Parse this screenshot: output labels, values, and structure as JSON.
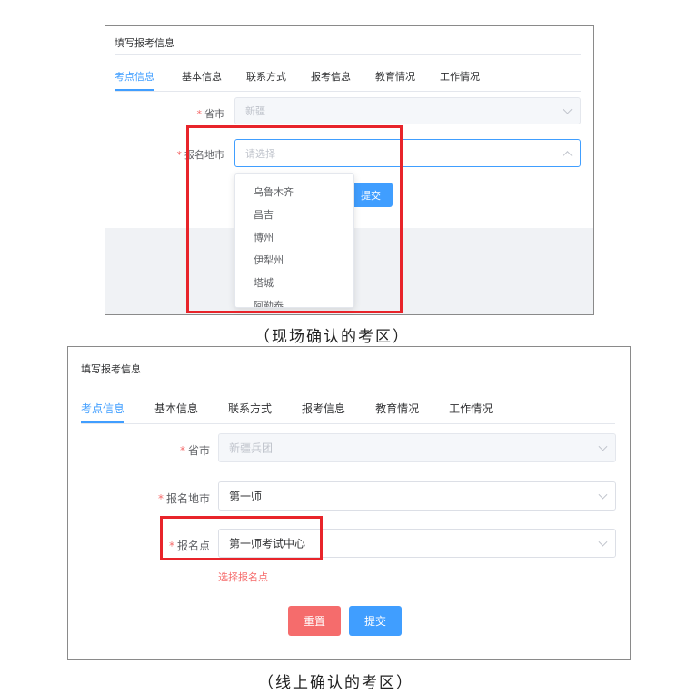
{
  "figure1": {
    "panel_title": "填写报考信息",
    "tabs": [
      "考点信息",
      "基本信息",
      "联系方式",
      "报考信息",
      "教育情况",
      "工作情况"
    ],
    "active_tab": 0,
    "required_mark": "*",
    "province_label": "省市",
    "province_value": "新疆",
    "city_label": "报名地市",
    "city_placeholder": "请选择",
    "submit_label": "提交",
    "dropdown_options": [
      "乌鲁木齐",
      "昌吉",
      "博州",
      "伊犁州",
      "塔城",
      "阿勒泰"
    ],
    "caption": "（现场确认的考区）"
  },
  "figure2": {
    "panel_title": "填写报考信息",
    "tabs": [
      "考点信息",
      "基本信息",
      "联系方式",
      "报考信息",
      "教育情况",
      "工作情况"
    ],
    "active_tab": 0,
    "required_mark": "*",
    "province_label": "省市",
    "province_value": "新疆兵团",
    "city_label": "报名地市",
    "city_value": "第一师",
    "site_label": "报名点",
    "site_value": "第一师考试中心",
    "site_hint": "选择报名点",
    "reset_label": "重置",
    "submit_label": "提交",
    "caption": "（线上确认的考区）"
  },
  "colors": {
    "primary": "#409eff",
    "danger": "#f56c6c",
    "highlight_box": "#e8242a"
  }
}
